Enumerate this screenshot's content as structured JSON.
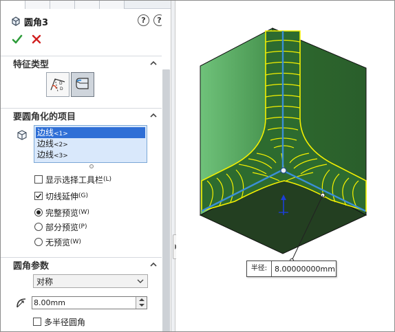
{
  "header": {
    "title": "圆角3",
    "help_glyph": "?",
    "info_glyph": "?"
  },
  "sections": {
    "feature_type": "特征类型",
    "items_to_fillet": "要圆角化的项目",
    "fillet_params": "圆角参数"
  },
  "items": {
    "list": [
      {
        "name": "边线",
        "index": "<1>"
      },
      {
        "name": "边线",
        "index": "<2>"
      },
      {
        "name": "边线",
        "index": "<3>"
      }
    ],
    "selected_index": 0
  },
  "options": {
    "show_selection_toolbar": {
      "label": "显示选择工具栏",
      "shortcut": "(L)",
      "checked": false
    },
    "tangent_propagation": {
      "label": "切线延伸",
      "shortcut": "(G)",
      "checked": true
    },
    "full_preview": {
      "label": "完整预览",
      "shortcut": "(W)",
      "selected": true
    },
    "partial_preview": {
      "label": "部分预览",
      "shortcut": "(P)",
      "selected": false
    },
    "no_preview": {
      "label": "无预览",
      "shortcut": "(W)",
      "selected": false
    }
  },
  "params": {
    "method": "对称",
    "radius": "8.00mm",
    "multi_radius": {
      "label": "多半径圆角",
      "checked": false
    }
  },
  "callout": {
    "label": "半径:",
    "value": "8.00000000mm"
  },
  "colors": {
    "accept": "#2e9c3a",
    "cancel": "#d11f1f",
    "face_green": "#2f6b2f",
    "fillet_yellow": "#f4f000",
    "edge_blue": "#3a8fd8"
  }
}
